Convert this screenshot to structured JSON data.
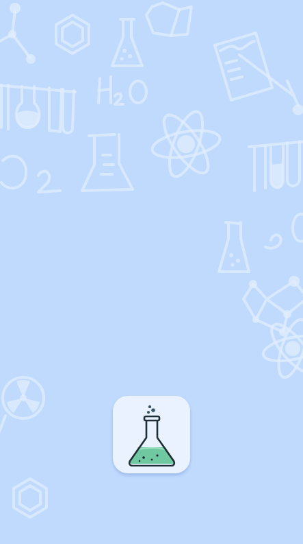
{
  "screen": {
    "name": "splash-screen",
    "background_color": "#c0dafd",
    "pattern_color": "#dfecfd",
    "background_icons": [
      "molecule-icon",
      "benzene-ring-icon",
      "erlenmeyer-flask-icon",
      "beaker-icon",
      "test-tube-rack-icon",
      "h2o-formula-icon",
      "atom-icon",
      "notebook-icon",
      "radiation-icon",
      "o2-formula-icon"
    ]
  },
  "app_icon": {
    "icon": "erlenmeyer-flask-icon",
    "tile_color": "#e9f2fe",
    "liquid_color": "#6fc8a0",
    "outline_color": "#1f2d36",
    "bubble_color": "#3a5566"
  }
}
